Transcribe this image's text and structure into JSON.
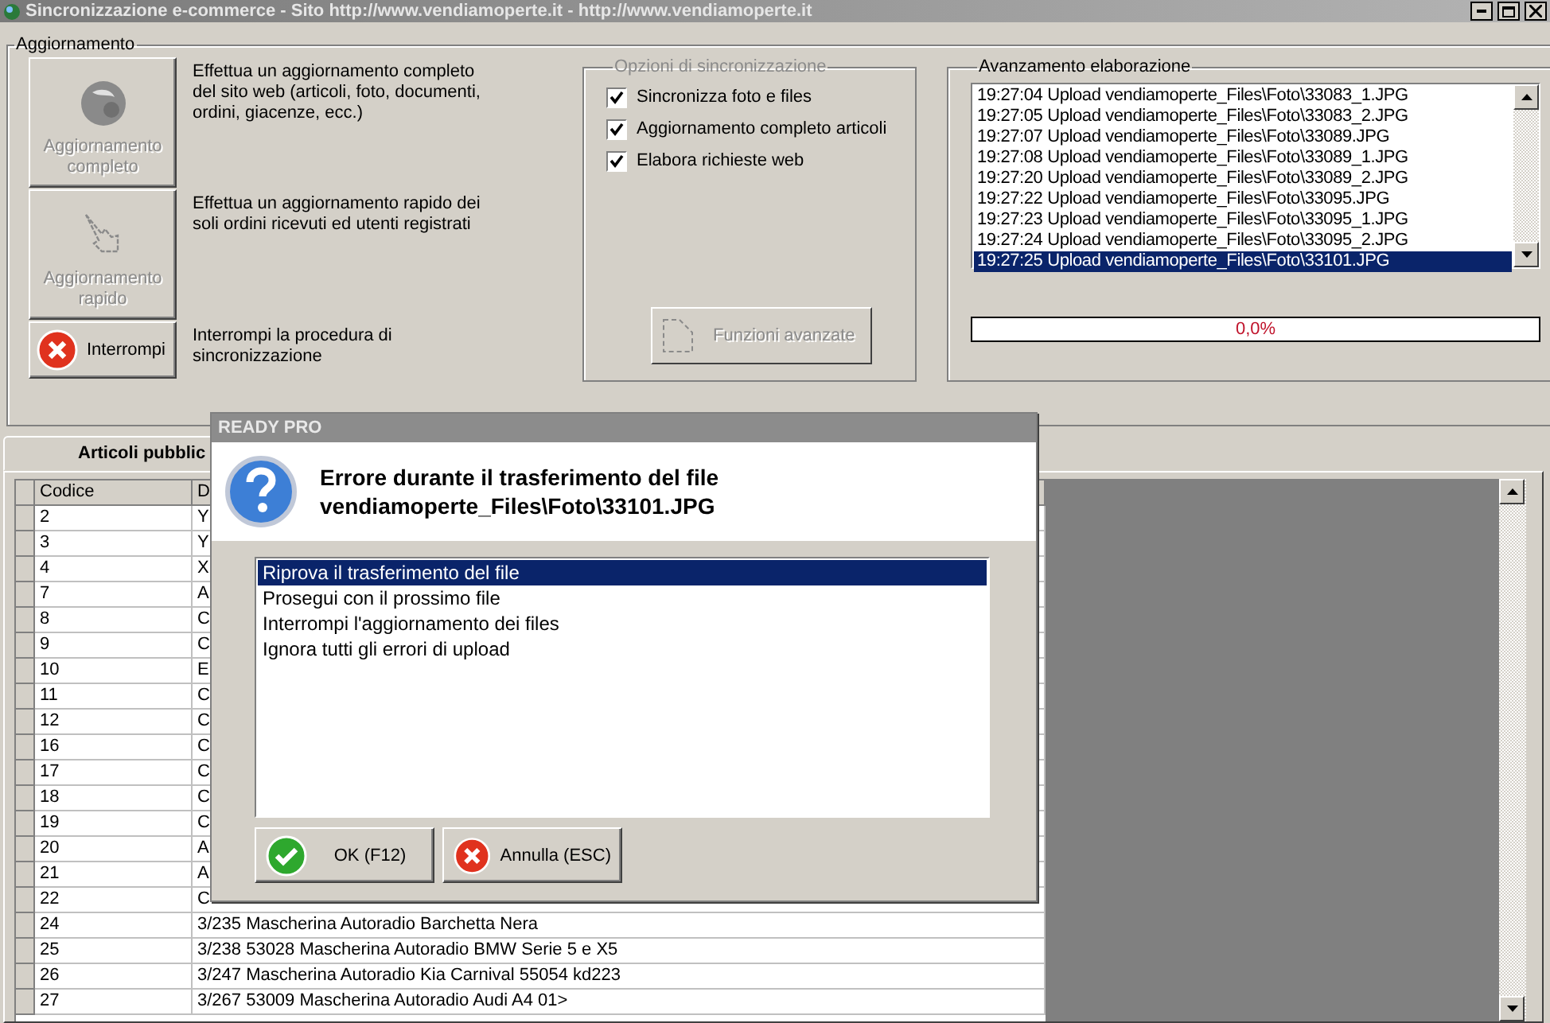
{
  "window": {
    "title": "Sincronizzazione e-commerce - Sito http://www.vendiamoperte.it - http://www.vendiamoperte.it"
  },
  "update_group": {
    "title": "Aggiornamento",
    "actions": [
      {
        "kind": "globe",
        "label": "Aggiornamento completo",
        "description": "Effettua un aggiornamento completo del sito web (articoli, foto, documenti, ordini, giacenze, ecc.)",
        "disabled": true
      },
      {
        "kind": "hand",
        "label": "Aggiornamento rapido",
        "description": "Effettua un aggiornamento rapido dei soli ordini ricevuti ed utenti registrati",
        "disabled": true
      },
      {
        "kind": "stop",
        "label": "Interrompi",
        "description": "Interrompi la procedura di sincronizzazione",
        "disabled": false
      }
    ]
  },
  "sync_options": {
    "title": "Opzioni di sincronizzazione",
    "disabled": true,
    "options": [
      {
        "label": "Sincronizza foto e files",
        "checked": true
      },
      {
        "label": "Aggiornamento completo articoli",
        "checked": true
      },
      {
        "label": "Elabora richieste web",
        "checked": true
      }
    ],
    "advanced_button": {
      "label": "Funzioni avanzate",
      "disabled": true
    }
  },
  "progress": {
    "title": "Avanzamento elaborazione",
    "log": [
      {
        "text": "19:27:04 Upload vendiamoperte_Files\\Foto\\33083_1.JPG",
        "selected": false
      },
      {
        "text": "19:27:05 Upload vendiamoperte_Files\\Foto\\33083_2.JPG",
        "selected": false
      },
      {
        "text": "19:27:07 Upload vendiamoperte_Files\\Foto\\33089.JPG",
        "selected": false
      },
      {
        "text": "19:27:08 Upload vendiamoperte_Files\\Foto\\33089_1.JPG",
        "selected": false
      },
      {
        "text": "19:27:20 Upload vendiamoperte_Files\\Foto\\33089_2.JPG",
        "selected": false
      },
      {
        "text": "19:27:22 Upload vendiamoperte_Files\\Foto\\33095.JPG",
        "selected": false
      },
      {
        "text": "19:27:23 Upload vendiamoperte_Files\\Foto\\33095_1.JPG",
        "selected": false
      },
      {
        "text": "19:27:24 Upload vendiamoperte_Files\\Foto\\33095_2.JPG",
        "selected": false
      },
      {
        "text": "19:27:25 Upload vendiamoperte_Files\\Foto\\33101.JPG",
        "selected": true
      }
    ],
    "level": 0,
    "reading": "0,0%"
  },
  "tabs": [
    {
      "label": "Articoli pubblic",
      "selected": true
    }
  ],
  "table": {
    "columns": [
      "Codice",
      "D"
    ],
    "rows": [
      [
        "2",
        "Y"
      ],
      [
        "3",
        "Y"
      ],
      [
        "4",
        "X"
      ],
      [
        "7",
        "A"
      ],
      [
        "8",
        "C"
      ],
      [
        "9",
        "C"
      ],
      [
        "10",
        "E"
      ],
      [
        "11",
        "C"
      ],
      [
        "12",
        "C"
      ],
      [
        "16",
        "C"
      ],
      [
        "17",
        "C"
      ],
      [
        "18",
        "C"
      ],
      [
        "19",
        "C"
      ],
      [
        "20",
        "A"
      ],
      [
        "21",
        "A"
      ],
      [
        "22",
        "C"
      ],
      [
        "24",
        "3/235 Mascherina Autoradio  Barchetta Nera"
      ],
      [
        "25",
        "3/238 53028 Mascherina Autoradio BMW Serie 5 e X5"
      ],
      [
        "26",
        "3/247 Mascherina Autoradio Kia Carnival 55054 kd223"
      ],
      [
        "27",
        "3/267 53009 Mascherina Autoradio Audi A4 01>"
      ]
    ]
  },
  "dialog": {
    "title": "READY PRO",
    "message": "Errore durante il trasferimento del file vendiamoperte_Files\\Foto\\33101.JPG",
    "choices": [
      {
        "label": "Riprova il trasferimento del file",
        "selected": true
      },
      {
        "label": "Prosegui con il prossimo file",
        "selected": false
      },
      {
        "label": "Interrompi l'aggiornamento dei files",
        "selected": false
      },
      {
        "label": "Ignora tutti gli errori di upload",
        "selected": false
      }
    ],
    "buttons": [
      {
        "kind": "ok",
        "label": "OK (F12)"
      },
      {
        "kind": "cancel",
        "label": "Annulla (ESC)"
      }
    ]
  }
}
